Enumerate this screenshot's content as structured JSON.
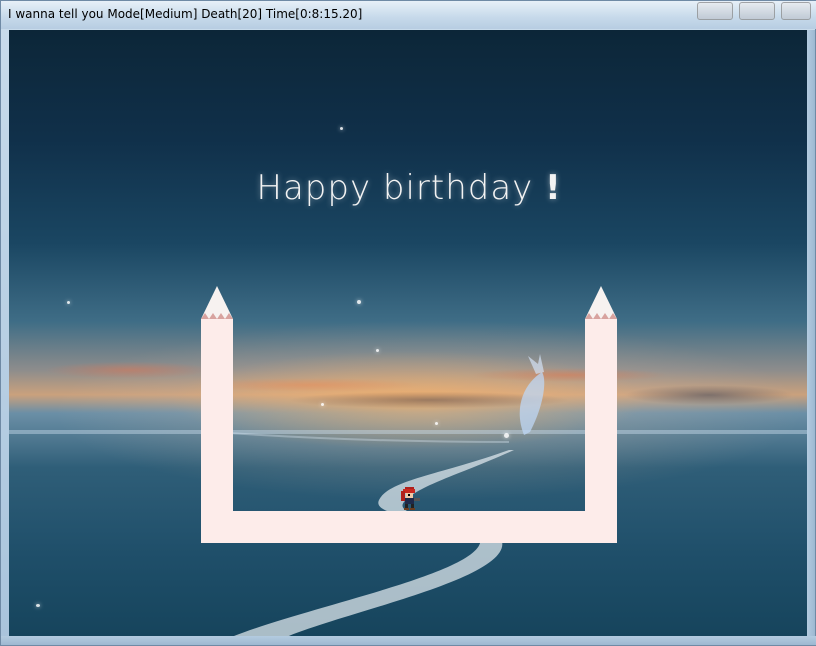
{
  "window": {
    "title": "I wanna tell you Mode[Medium] Death[20] Time[0:8:15.20]",
    "title_parts": {
      "game_name": "I wanna tell you",
      "mode": "Medium",
      "deaths": 20,
      "time": "0:8:15.20"
    }
  },
  "scene": {
    "headline_main": "Happy birthday",
    "headline_bang": "!"
  },
  "colors": {
    "platform": "#fdecea",
    "spike_tip": "#f7f2f0",
    "spike_band": "#d8a39f",
    "sky_top": "#0c2638",
    "sunset": "#caa17d",
    "sea": "#16445c"
  },
  "icons": {
    "player": "kid-sprite",
    "fish": "fish-spirit",
    "left_spike": "spike-up",
    "right_spike": "spike-up"
  }
}
